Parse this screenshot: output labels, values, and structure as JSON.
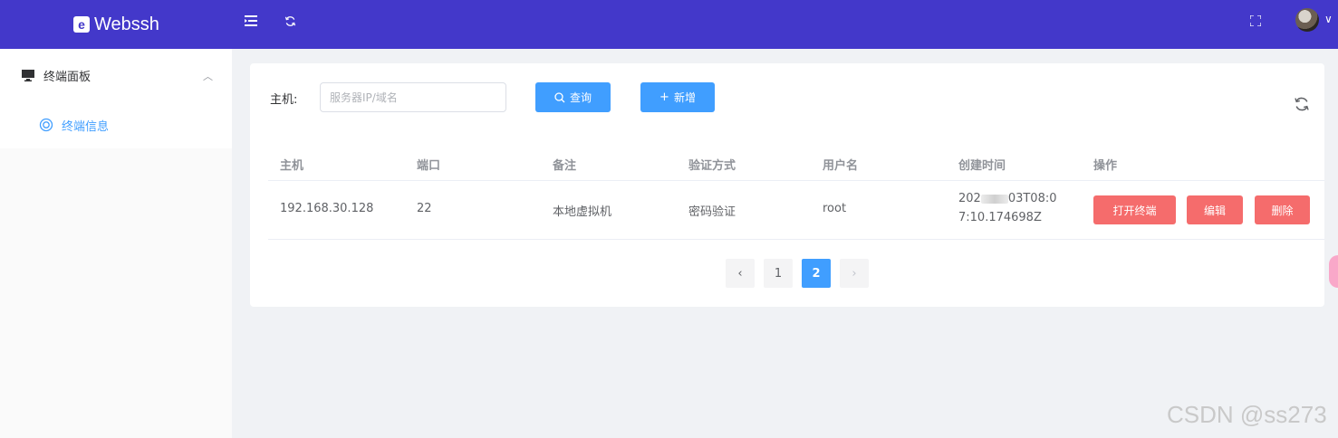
{
  "app": {
    "logo_mark": "e",
    "title": "Webssh"
  },
  "header_icons": {
    "menu": "menu-fold-icon",
    "refresh": "refresh-icon",
    "fullscreen": "fullscreen-icon",
    "caret": "chevron-down-icon"
  },
  "sidebar": {
    "parent": {
      "label": "终端面板",
      "icon": "monitor-icon",
      "caret": "chevron-up-icon"
    },
    "child": {
      "label": "终端信息",
      "icon": "ring-icon"
    }
  },
  "filter": {
    "label": "主机:",
    "placeholder": "服务器IP/域名",
    "value": ""
  },
  "buttons": {
    "query": "查询",
    "add": "新增"
  },
  "table": {
    "columns": [
      "主机",
      "端口",
      "备注",
      "验证方式",
      "用户名",
      "创建时间",
      "操作"
    ],
    "rows": [
      {
        "host": "192.168.30.128",
        "port": "22",
        "note": "本地虚拟机",
        "auth": "密码验证",
        "user": "root",
        "created_a": "202",
        "created_b": "03T08:0",
        "created_c": "7:10.174698Z",
        "ops": [
          "打开终端",
          "编辑",
          "删除"
        ]
      }
    ]
  },
  "pagination": {
    "prev": "‹",
    "pages": [
      "1",
      "2"
    ],
    "current": "2",
    "next": "›"
  },
  "colors": {
    "header": "#4338ca",
    "primary": "#409eff",
    "danger": "#f56c6c"
  },
  "watermark": "CSDN @ss273"
}
